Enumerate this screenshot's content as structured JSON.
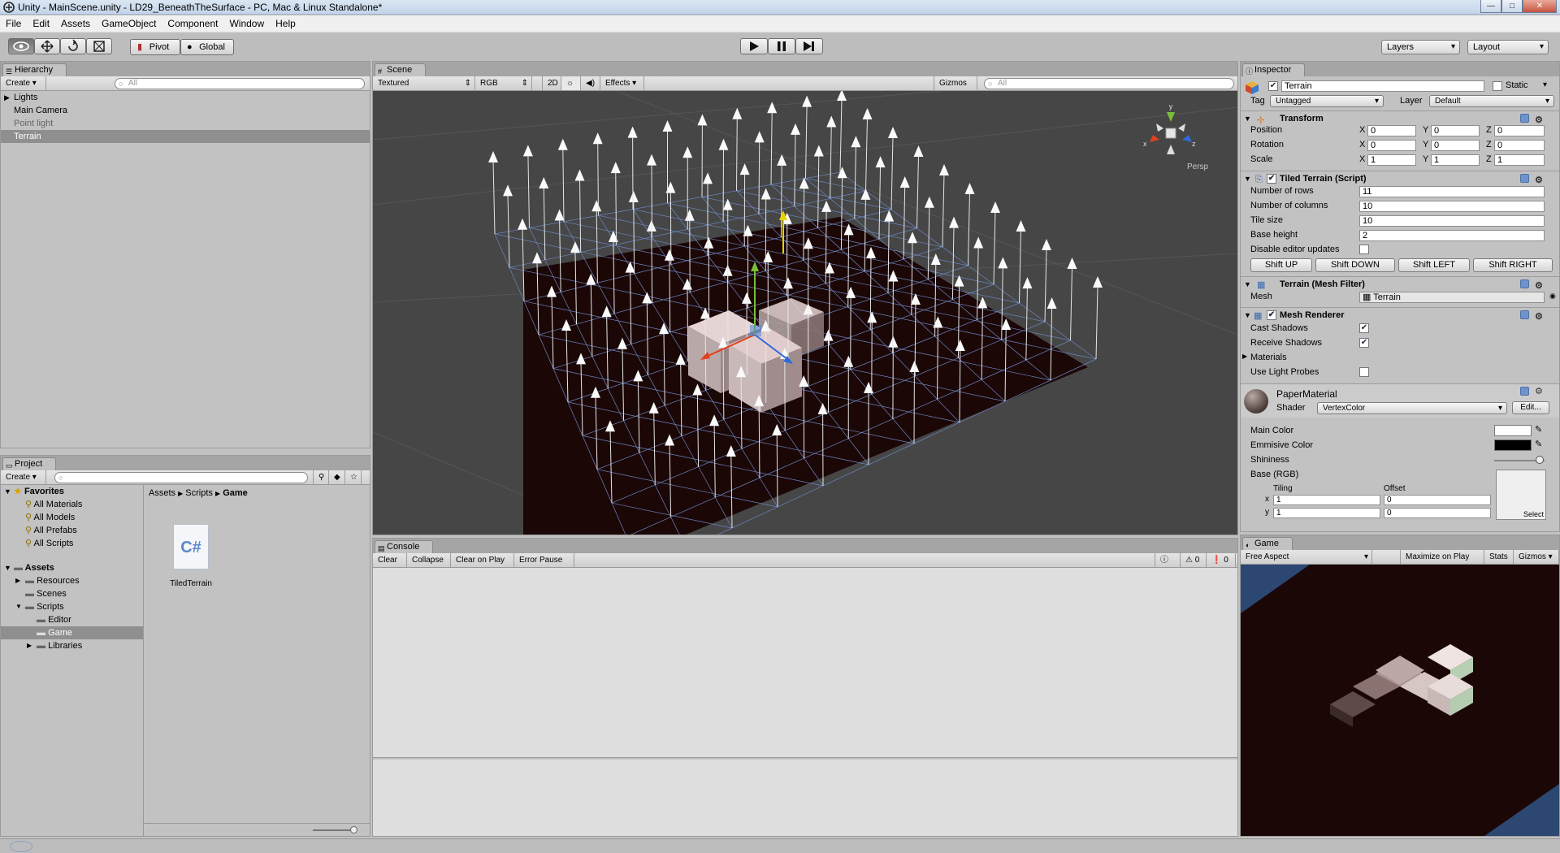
{
  "window": {
    "title": "Unity - MainScene.unity - LD29_BeneathTheSurface - PC, Mac & Linux Standalone*",
    "buttons": [
      "—",
      "□",
      "✕"
    ]
  },
  "menu": [
    "File",
    "Edit",
    "Assets",
    "GameObject",
    "Component",
    "Window",
    "Help"
  ],
  "toolbar": {
    "pivot": "Pivot",
    "global": "Global",
    "layers": "Layers",
    "layout": "Layout"
  },
  "hierarchy": {
    "tab": "Hierarchy",
    "create": "Create",
    "search_placeholder": "All",
    "items": [
      {
        "label": "Lights",
        "state": "normal",
        "expandable": true
      },
      {
        "label": "Main Camera",
        "state": "normal",
        "expandable": false
      },
      {
        "label": "Point light",
        "state": "dim",
        "expandable": false
      },
      {
        "label": "Terrain",
        "state": "selected",
        "expandable": false
      }
    ]
  },
  "scene": {
    "tab": "Scene",
    "render_mode": "Textured",
    "color_mode": "RGB",
    "mode_2d": "2D",
    "effects": "Effects",
    "gizmos": "Gizmos",
    "search_placeholder": "All",
    "persp": "Persp",
    "axes": {
      "x": "x",
      "y": "y",
      "z": "z"
    }
  },
  "project": {
    "tab": "Project",
    "create": "Create",
    "favorites": {
      "title": "Favorites",
      "items": [
        "All Materials",
        "All Models",
        "All Prefabs",
        "All Scripts"
      ]
    },
    "assets": {
      "title": "Assets",
      "items": [
        {
          "label": "Resources",
          "indent": 1,
          "expandable": true
        },
        {
          "label": "Scenes",
          "indent": 1,
          "expandable": false
        },
        {
          "label": "Scripts",
          "indent": 1,
          "expandable": true
        },
        {
          "label": "Editor",
          "indent": 2,
          "expandable": false
        },
        {
          "label": "Game",
          "indent": 2,
          "expandable": false,
          "selected": true
        },
        {
          "label": "Libraries",
          "indent": 2,
          "expandable": true
        }
      ]
    },
    "breadcrumb": [
      "Assets",
      "Scripts",
      "Game"
    ],
    "file": {
      "name": "TiledTerrain",
      "icon_text": "C#"
    }
  },
  "console": {
    "tab": "Console",
    "buttons": [
      "Clear",
      "Collapse",
      "Clear on Play",
      "Error Pause"
    ],
    "counts": {
      "info": "0",
      "warning": "0",
      "error": "0"
    }
  },
  "inspector": {
    "tab": "Inspector",
    "object_name": "Terrain",
    "static_label": "Static",
    "tag_label": "Tag",
    "tag_value": "Untagged",
    "layer_label": "Layer",
    "layer_value": "Default",
    "transform": {
      "title": "Transform",
      "rows": [
        {
          "label": "Position",
          "x": "0",
          "y": "0",
          "z": "0"
        },
        {
          "label": "Rotation",
          "x": "0",
          "y": "0",
          "z": "0"
        },
        {
          "label": "Scale",
          "x": "1",
          "y": "1",
          "z": "1"
        }
      ],
      "axis_labels": [
        "X",
        "Y",
        "Z"
      ]
    },
    "tiled_terrain": {
      "title": "Tiled Terrain (Script)",
      "fields": [
        {
          "label": "Number of rows",
          "value": "11"
        },
        {
          "label": "Number of columns",
          "value": "10"
        },
        {
          "label": "Tile size",
          "value": "10"
        },
        {
          "label": "Base height",
          "value": "2"
        }
      ],
      "disable_label": "Disable editor updates",
      "buttons": [
        "Shift UP",
        "Shift DOWN",
        "Shift LEFT",
        "Shift RIGHT"
      ]
    },
    "mesh_filter": {
      "title": "Terrain (Mesh Filter)",
      "mesh_label": "Mesh",
      "mesh_value": "Terrain"
    },
    "mesh_renderer": {
      "title": "Mesh Renderer",
      "cast_shadows": "Cast Shadows",
      "receive_shadows": "Receive Shadows",
      "materials": "Materials",
      "light_probes": "Use Light Probes"
    },
    "material": {
      "name": "PaperMaterial",
      "shader_label": "Shader",
      "shader_value": "VertexColor",
      "edit": "Edit...",
      "main_color": "Main Color",
      "emissive": "Emmisive Color",
      "shininess": "Shininess",
      "base": "Base (RGB)",
      "tiling": "Tiling",
      "offset": "Offset",
      "tx": "1",
      "ty": "1",
      "ox": "0",
      "oy": "0",
      "x": "x",
      "y": "y",
      "select": "Select",
      "shininess_value": 0.9
    }
  },
  "game": {
    "tab": "Game",
    "aspect": "Free Aspect",
    "maximize": "Maximize on Play",
    "stats": "Stats",
    "gizmos": "Gizmos"
  },
  "colors": {
    "terrain": "#1c0707",
    "grid_line": "#6a86c0",
    "scene_bg": "#464646",
    "game_bg": "#2c4772",
    "selection": "#8f8f8f"
  }
}
